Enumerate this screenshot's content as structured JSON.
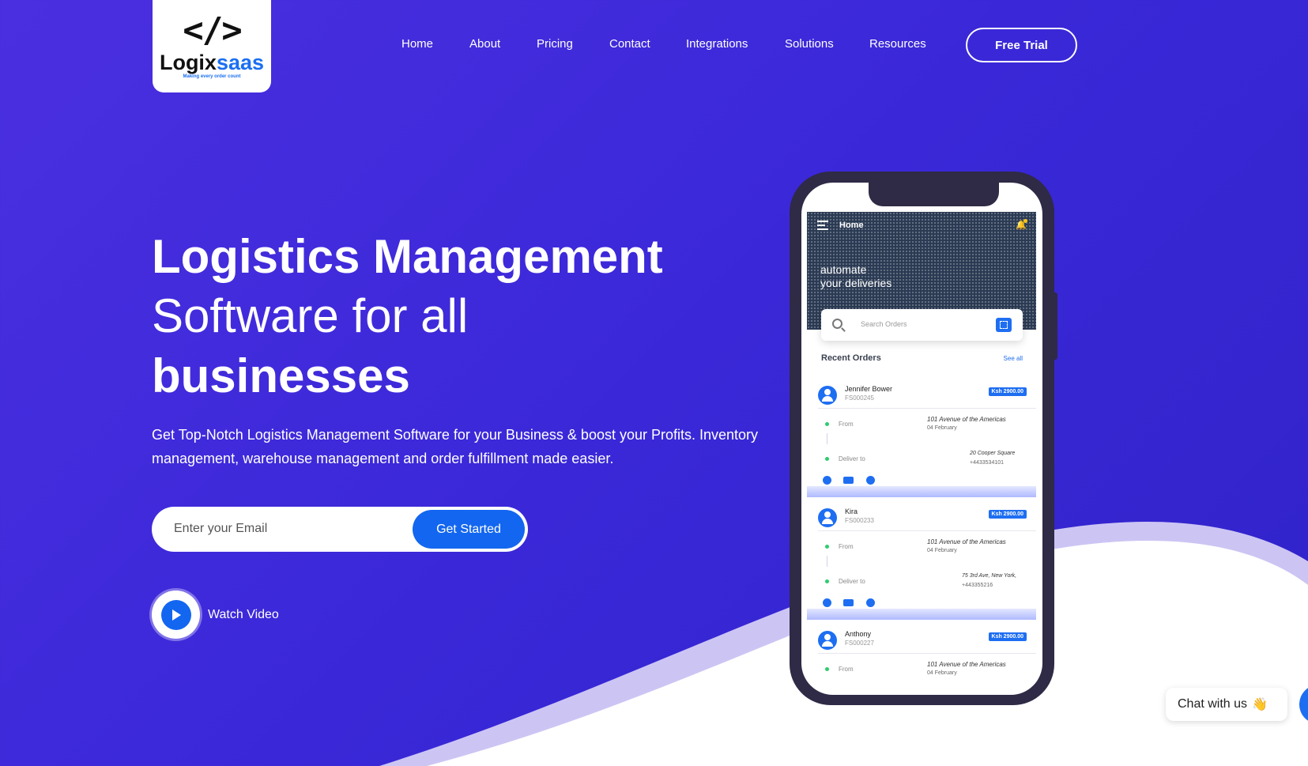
{
  "header": {
    "logo": {
      "glyph": "</>",
      "word_part1": "Logix",
      "word_part2": "saas",
      "tagline": "Making every order count"
    },
    "nav": [
      "Home",
      "About",
      "Pricing",
      "Contact",
      "Integrations",
      "Solutions",
      "Resources"
    ],
    "cta_label": "Free Trial"
  },
  "hero": {
    "title_line1": "Logistics Management",
    "title_line2": "Software for all",
    "title_line3": "businesses",
    "description": "Get Top-Notch Logistics Management Software for your Business & boost your Profits. Inventory management, warehouse management and order fulfillment made easier.",
    "email_placeholder": "Enter your Email",
    "submit_label": "Get Started",
    "video_label": "Watch Video"
  },
  "phone_app": {
    "title": "Home",
    "tagline_line1": "automate",
    "tagline_line2": "your deliveries",
    "search_placeholder": "Search Orders",
    "recent_label": "Recent Orders",
    "see_all_label": "See all",
    "from_label": "From",
    "deliver_label": "Deliver to",
    "orders": [
      {
        "name": "Jennifer Bower",
        "id": "FS000245",
        "price": "Ksh 2900.00",
        "from_address": "101 Avenue of the Americas",
        "from_date": "04 February",
        "to_address": "20 Cooper Square",
        "to_phone": "+4433534101"
      },
      {
        "name": "Kira",
        "id": "FS000233",
        "price": "Ksh 2900.00",
        "from_address": "101 Avenue of the Americas",
        "from_date": "04 February",
        "to_address": "75 3rd Ave, New York,",
        "to_phone": "+443355216"
      },
      {
        "name": "Anthony",
        "id": "FS000227",
        "price": "Ksh 2900.00",
        "from_address": "101 Avenue of the Americas",
        "from_date": "04 February"
      }
    ]
  },
  "chat_widget": {
    "label": "Chat with us",
    "emoji": "👋"
  },
  "colors": {
    "background": "#3a28d8",
    "accent": "#1366f0",
    "phone_frame": "#2f2a45",
    "status_dot": "#2ecc71"
  }
}
